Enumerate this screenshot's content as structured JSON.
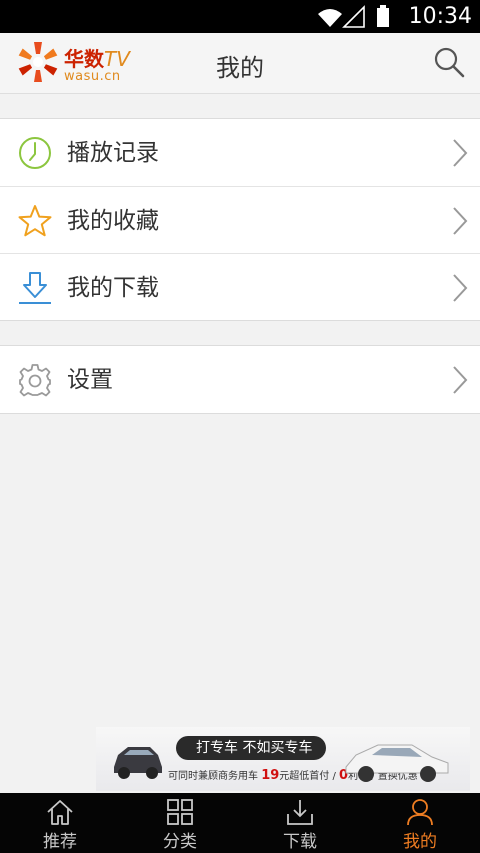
{
  "status_bar": {
    "time": "10:34"
  },
  "header": {
    "logo_cn": "华数",
    "logo_tv": "TV",
    "logo_sub": "wasu.cn",
    "title": "我的"
  },
  "menu": {
    "group1": [
      {
        "label": "播放记录",
        "icon": "clock-icon"
      },
      {
        "label": "我的收藏",
        "icon": "star-icon"
      },
      {
        "label": "我的下载",
        "icon": "download-icon"
      }
    ],
    "group2": [
      {
        "label": "设置",
        "icon": "gear-icon"
      }
    ]
  },
  "ad": {
    "headline": "打专车 不如买专车",
    "detail_a": "可同时兼顾商务用车",
    "detail_b_num": "19",
    "detail_b": "元超低首付 /",
    "detail_c_num": "0",
    "detail_c": "利率 / 置换优惠"
  },
  "tabs": [
    {
      "label": "推荐",
      "icon": "home-icon",
      "active": false
    },
    {
      "label": "分类",
      "icon": "grid-icon",
      "active": false
    },
    {
      "label": "下载",
      "icon": "download-tray-icon",
      "active": false
    },
    {
      "label": "我的",
      "icon": "person-icon",
      "active": true
    }
  ],
  "colors": {
    "accent": "#ee7d22",
    "brand_red": "#cc2200",
    "clock_green": "#8cc63f",
    "star_orange": "#f0a11e",
    "download_blue": "#3a8fd6",
    "gear_gray": "#9a9a9a"
  }
}
